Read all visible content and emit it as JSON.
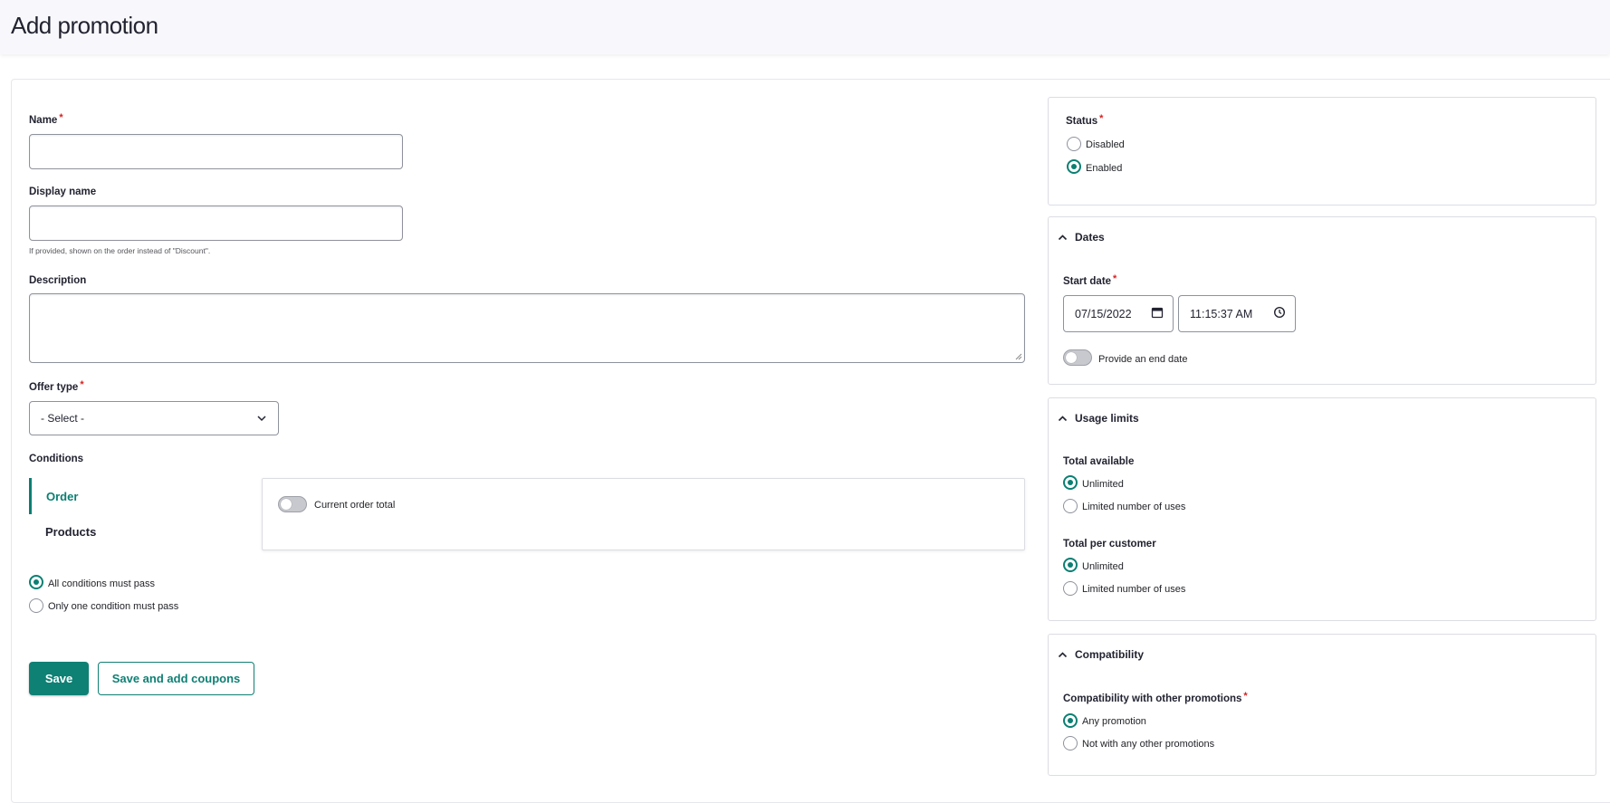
{
  "page": {
    "title": "Add promotion"
  },
  "form": {
    "name": {
      "label": "Name",
      "value": ""
    },
    "display_name": {
      "label": "Display name",
      "value": "",
      "help": "If provided, shown on the order instead of \"Discount\"."
    },
    "description": {
      "label": "Description",
      "value": ""
    },
    "offer_type": {
      "label": "Offer type",
      "selected": "- Select -"
    },
    "conditions": {
      "label": "Conditions",
      "tabs": [
        {
          "label": "Order",
          "active": true
        },
        {
          "label": "Products",
          "active": false
        }
      ],
      "current_order_total": "Current order total",
      "operator_options": [
        {
          "label": "All conditions must pass",
          "checked": true
        },
        {
          "label": "Only one condition must pass",
          "checked": false
        }
      ]
    },
    "buttons": {
      "save": "Save",
      "save_and_add_coupons": "Save and add coupons"
    }
  },
  "sidebar": {
    "status": {
      "label": "Status",
      "options": [
        {
          "label": "Disabled",
          "checked": false
        },
        {
          "label": "Enabled",
          "checked": true
        }
      ]
    },
    "dates": {
      "title": "Dates",
      "start_date_label": "Start date",
      "date_value": "07/15/2022",
      "time_value": "11:15:37 AM",
      "end_date_toggle": "Provide an end date"
    },
    "usage_limits": {
      "title": "Usage limits",
      "total_available": {
        "label": "Total available",
        "options": [
          {
            "label": "Unlimited",
            "checked": true
          },
          {
            "label": "Limited number of uses",
            "checked": false
          }
        ]
      },
      "total_per_customer": {
        "label": "Total per customer",
        "options": [
          {
            "label": "Unlimited",
            "checked": true
          },
          {
            "label": "Limited number of uses",
            "checked": false
          }
        ]
      }
    },
    "compatibility": {
      "title": "Compatibility",
      "label": "Compatibility with other promotions",
      "options": [
        {
          "label": "Any promotion",
          "checked": true
        },
        {
          "label": "Not with any other promotions",
          "checked": false
        }
      ]
    }
  },
  "colors": {
    "accent": "#0f8074",
    "required": "#d72222",
    "header_bg": "#f8f8fc"
  }
}
